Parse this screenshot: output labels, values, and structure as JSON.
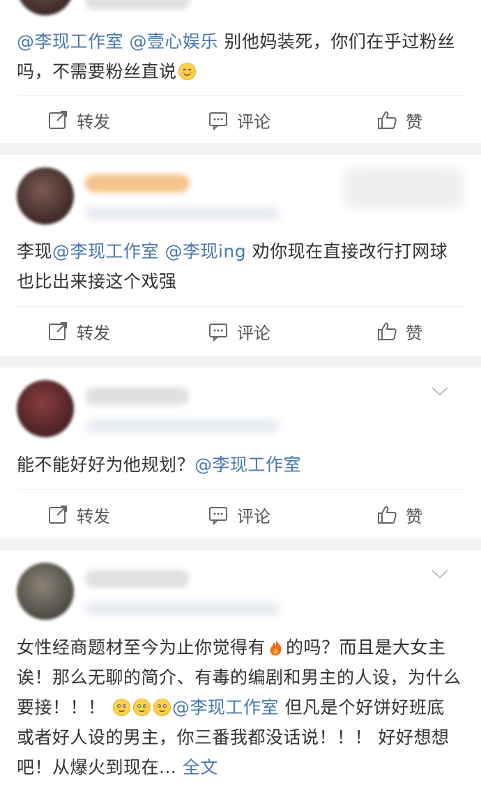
{
  "feed": {
    "posts": [
      {
        "segments": [
          {
            "type": "mention",
            "text": "@李现工作室"
          },
          {
            "type": "text",
            "text": " "
          },
          {
            "type": "mention",
            "text": "@壹心娱乐"
          },
          {
            "type": "text",
            "text": " 别他妈装死，你们在乎过粉丝吗，不需要粉丝直说"
          },
          {
            "type": "emoji",
            "name": "smile-emoji"
          }
        ],
        "actions": {
          "repost": "转发",
          "comment": "评论",
          "like": "赞"
        }
      },
      {
        "segments": [
          {
            "type": "text",
            "text": "李现"
          },
          {
            "type": "mention",
            "text": "@李现工作室"
          },
          {
            "type": "text",
            "text": " "
          },
          {
            "type": "mention",
            "text": "@李现ing"
          },
          {
            "type": "text",
            "text": " 劝你现在直接改行打网球也比出来接这个戏强"
          }
        ],
        "actions": {
          "repost": "转发",
          "comment": "评论",
          "like": "赞"
        }
      },
      {
        "segments": [
          {
            "type": "text",
            "text": "能不能好好为他规划？"
          },
          {
            "type": "mention",
            "text": "@李现工作室"
          }
        ],
        "actions": {
          "repost": "转发",
          "comment": "评论",
          "like": "赞"
        }
      },
      {
        "segments": [
          {
            "type": "text",
            "text": "女性经商题材至今为止你觉得有"
          },
          {
            "type": "emoji",
            "name": "fire-emoji"
          },
          {
            "type": "text",
            "text": "的吗？而且是大女主诶！那么无聊的简介、有毒的编剧和男主的人设，为什么要接！！！ "
          },
          {
            "type": "emoji",
            "name": "meh-emoji"
          },
          {
            "type": "emoji",
            "name": "meh-emoji"
          },
          {
            "type": "emoji",
            "name": "meh-emoji"
          },
          {
            "type": "mention",
            "text": "@李现工作室"
          },
          {
            "type": "text",
            "text": "  但凡是个好饼好班底或者好人设的男主，你三番我都没话说！！！  好好想想吧！从爆火到现在..."
          },
          {
            "type": "more",
            "text": " 全文"
          }
        ],
        "actions": null
      }
    ]
  },
  "icons": {
    "repost": "share-square-icon",
    "comment": "comment-icon",
    "like": "thumbs-up-icon",
    "menu": "chevron-down-icon"
  },
  "colors": {
    "mention": "#4a78b0",
    "text": "#333333",
    "action_text": "#555555",
    "background": "#f2f2f2"
  }
}
